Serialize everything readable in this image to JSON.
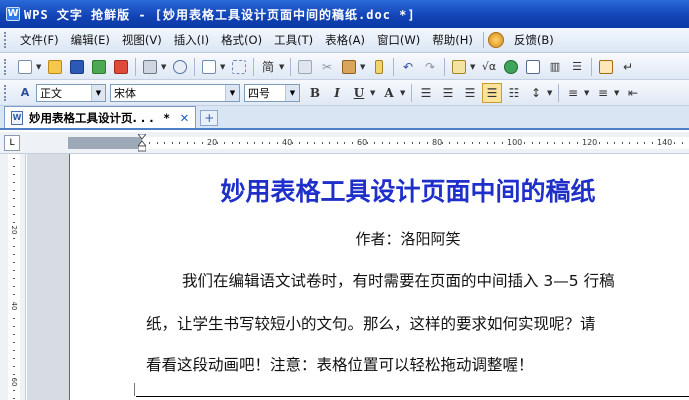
{
  "window": {
    "title": "WPS 文字 抢鲜版 - [妙用表格工具设计页面中间的稿纸.doc *]"
  },
  "menu": {
    "items": [
      "文件(F)",
      "编辑(E)",
      "视图(V)",
      "插入(I)",
      "格式(O)",
      "工具(T)",
      "表格(A)",
      "窗口(W)",
      "帮助(H)"
    ],
    "feedback": "反馈(B)"
  },
  "toolbar": {
    "simplified_label": "简"
  },
  "format_bar": {
    "style_value": "正文",
    "font_value": "宋体",
    "size_value": "四号"
  },
  "tabs": {
    "document_tab": "妙用表格工具设计页. . .",
    "modified_marker": "*"
  },
  "ruler": {
    "h_numbers": [
      "20",
      "40",
      "60",
      "80",
      "100",
      "120",
      "140"
    ],
    "v_numbers": [
      "20",
      "40",
      "60"
    ]
  },
  "document": {
    "title": "妙用表格工具设计页面中间的稿纸",
    "author": "作者：洛阳阿笑",
    "paragraph_lines": [
      "我们在编辑语文试卷时，有时需要在页面的中间插入 3—5 行稿",
      "纸，让学生书写较短小的文句。那么，这样的要求如何实现呢？请",
      "看看这段动画吧！注意：表格位置可以轻松拖动调整喔！"
    ]
  },
  "colors": {
    "title_bar": "#1242b4",
    "doc_title": "#1f2fc9",
    "active_button": "#ffe39a"
  }
}
